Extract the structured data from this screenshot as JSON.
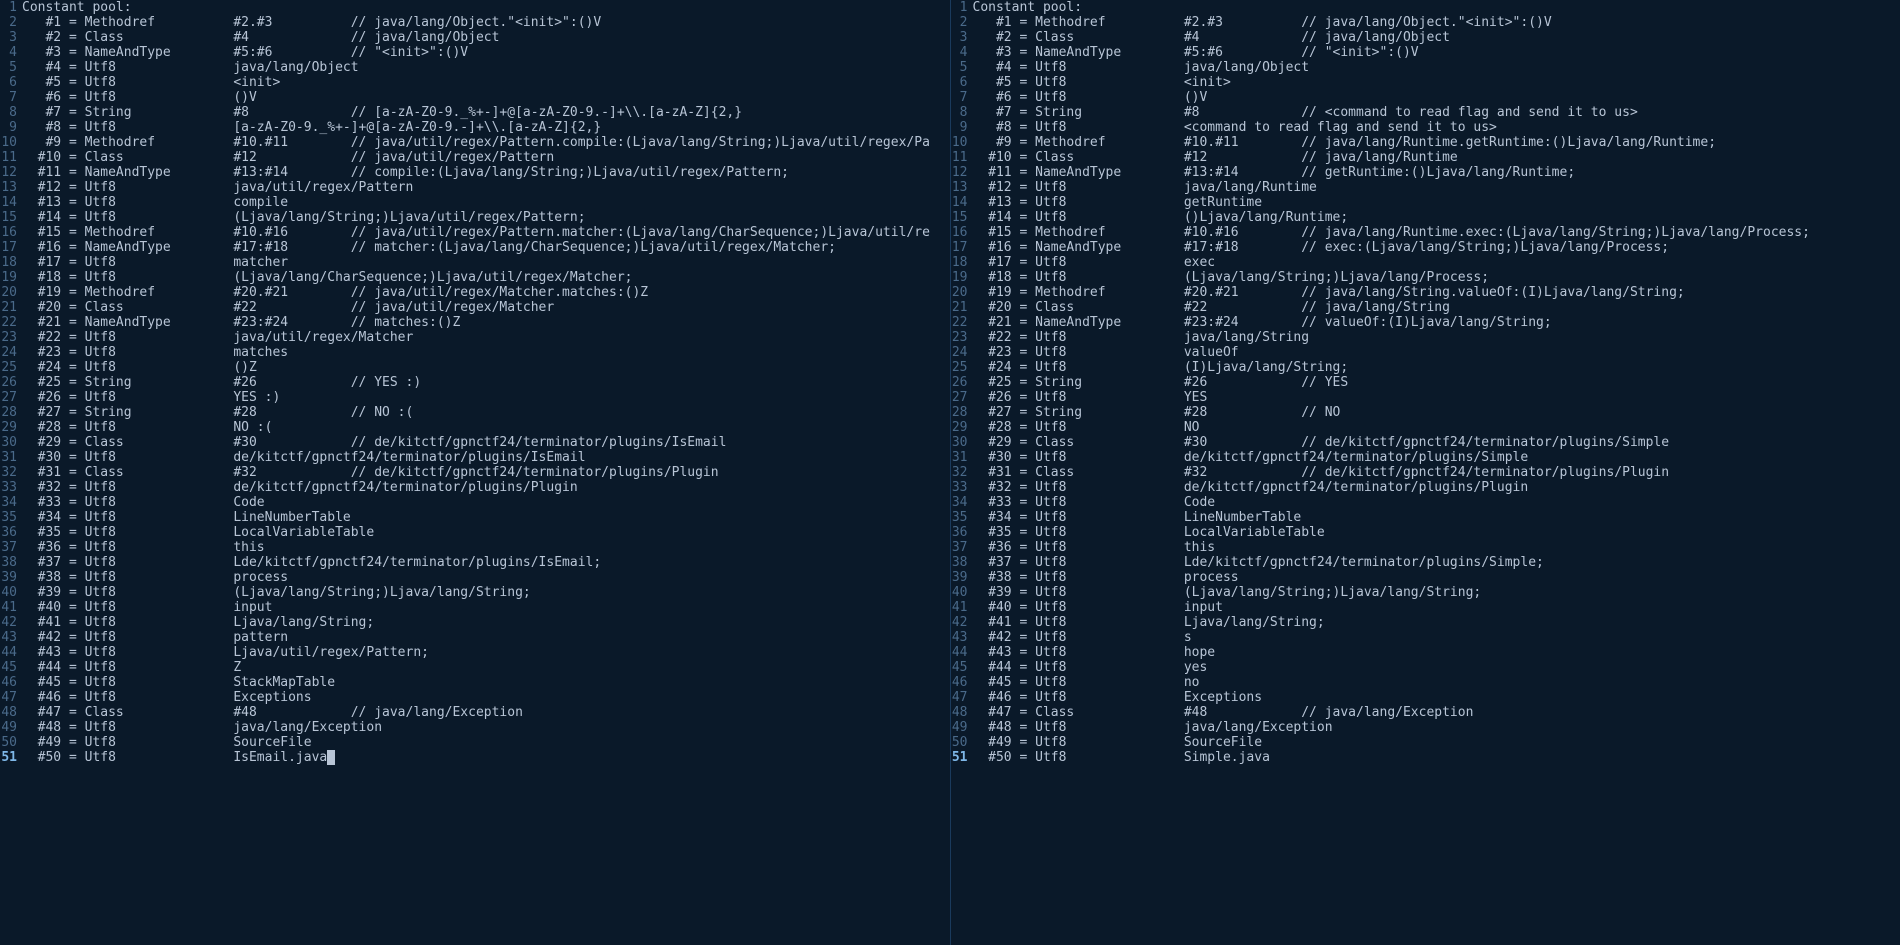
{
  "panes": [
    {
      "current_line": 51,
      "lines": [
        "Constant pool:",
        "   #1 = Methodref          #2.#3          // java/lang/Object.\"<init>\":()V",
        "   #2 = Class              #4             // java/lang/Object",
        "   #3 = NameAndType        #5:#6          // \"<init>\":()V",
        "   #4 = Utf8               java/lang/Object",
        "   #5 = Utf8               <init>",
        "   #6 = Utf8               ()V",
        "   #7 = String             #8             // [a-zA-Z0-9._%+-]+@[a-zA-Z0-9.-]+\\\\.[a-zA-Z]{2,}",
        "   #8 = Utf8               [a-zA-Z0-9._%+-]+@[a-zA-Z0-9.-]+\\\\.[a-zA-Z]{2,}",
        "   #9 = Methodref          #10.#11        // java/util/regex/Pattern.compile:(Ljava/lang/String;)Ljava/util/regex/Pa",
        "  #10 = Class              #12            // java/util/regex/Pattern",
        "  #11 = NameAndType        #13:#14        // compile:(Ljava/lang/String;)Ljava/util/regex/Pattern;",
        "  #12 = Utf8               java/util/regex/Pattern",
        "  #13 = Utf8               compile",
        "  #14 = Utf8               (Ljava/lang/String;)Ljava/util/regex/Pattern;",
        "  #15 = Methodref          #10.#16        // java/util/regex/Pattern.matcher:(Ljava/lang/CharSequence;)Ljava/util/re",
        "  #16 = NameAndType        #17:#18        // matcher:(Ljava/lang/CharSequence;)Ljava/util/regex/Matcher;",
        "  #17 = Utf8               matcher",
        "  #18 = Utf8               (Ljava/lang/CharSequence;)Ljava/util/regex/Matcher;",
        "  #19 = Methodref          #20.#21        // java/util/regex/Matcher.matches:()Z",
        "  #20 = Class              #22            // java/util/regex/Matcher",
        "  #21 = NameAndType        #23:#24        // matches:()Z",
        "  #22 = Utf8               java/util/regex/Matcher",
        "  #23 = Utf8               matches",
        "  #24 = Utf8               ()Z",
        "  #25 = String             #26            // YES :)",
        "  #26 = Utf8               YES :)",
        "  #27 = String             #28            // NO :(",
        "  #28 = Utf8               NO :(",
        "  #29 = Class              #30            // de/kitctf/gpnctf24/terminator/plugins/IsEmail",
        "  #30 = Utf8               de/kitctf/gpnctf24/terminator/plugins/IsEmail",
        "  #31 = Class              #32            // de/kitctf/gpnctf24/terminator/plugins/Plugin",
        "  #32 = Utf8               de/kitctf/gpnctf24/terminator/plugins/Plugin",
        "  #33 = Utf8               Code",
        "  #34 = Utf8               LineNumberTable",
        "  #35 = Utf8               LocalVariableTable",
        "  #36 = Utf8               this",
        "  #37 = Utf8               Lde/kitctf/gpnctf24/terminator/plugins/IsEmail;",
        "  #38 = Utf8               process",
        "  #39 = Utf8               (Ljava/lang/String;)Ljava/lang/String;",
        "  #40 = Utf8               input",
        "  #41 = Utf8               Ljava/lang/String;",
        "  #42 = Utf8               pattern",
        "  #43 = Utf8               Ljava/util/regex/Pattern;",
        "  #44 = Utf8               Z",
        "  #45 = Utf8               StackMapTable",
        "  #46 = Utf8               Exceptions",
        "  #47 = Class              #48            // java/lang/Exception",
        "  #48 = Utf8               java/lang/Exception",
        "  #49 = Utf8               SourceFile",
        "  #50 = Utf8               IsEmail.java"
      ]
    },
    {
      "current_line": 51,
      "lines": [
        "Constant pool:",
        "   #1 = Methodref          #2.#3          // java/lang/Object.\"<init>\":()V",
        "   #2 = Class              #4             // java/lang/Object",
        "   #3 = NameAndType        #5:#6          // \"<init>\":()V",
        "   #4 = Utf8               java/lang/Object",
        "   #5 = Utf8               <init>",
        "   #6 = Utf8               ()V",
        "   #7 = String             #8             // <command to read flag and send it to us>",
        "   #8 = Utf8               <command to read flag and send it to us>",
        "   #9 = Methodref          #10.#11        // java/lang/Runtime.getRuntime:()Ljava/lang/Runtime;",
        "  #10 = Class              #12            // java/lang/Runtime",
        "  #11 = NameAndType        #13:#14        // getRuntime:()Ljava/lang/Runtime;",
        "  #12 = Utf8               java/lang/Runtime",
        "  #13 = Utf8               getRuntime",
        "  #14 = Utf8               ()Ljava/lang/Runtime;",
        "  #15 = Methodref          #10.#16        // java/lang/Runtime.exec:(Ljava/lang/String;)Ljava/lang/Process;",
        "  #16 = NameAndType        #17:#18        // exec:(Ljava/lang/String;)Ljava/lang/Process;",
        "  #17 = Utf8               exec",
        "  #18 = Utf8               (Ljava/lang/String;)Ljava/lang/Process;",
        "  #19 = Methodref          #20.#21        // java/lang/String.valueOf:(I)Ljava/lang/String;",
        "  #20 = Class              #22            // java/lang/String",
        "  #21 = NameAndType        #23:#24        // valueOf:(I)Ljava/lang/String;",
        "  #22 = Utf8               java/lang/String",
        "  #23 = Utf8               valueOf",
        "  #24 = Utf8               (I)Ljava/lang/String;",
        "  #25 = String             #26            // YES",
        "  #26 = Utf8               YES",
        "  #27 = String             #28            // NO",
        "  #28 = Utf8               NO",
        "  #29 = Class              #30            // de/kitctf/gpnctf24/terminator/plugins/Simple",
        "  #30 = Utf8               de/kitctf/gpnctf24/terminator/plugins/Simple",
        "  #31 = Class              #32            // de/kitctf/gpnctf24/terminator/plugins/Plugin",
        "  #32 = Utf8               de/kitctf/gpnctf24/terminator/plugins/Plugin",
        "  #33 = Utf8               Code",
        "  #34 = Utf8               LineNumberTable",
        "  #35 = Utf8               LocalVariableTable",
        "  #36 = Utf8               this",
        "  #37 = Utf8               Lde/kitctf/gpnctf24/terminator/plugins/Simple;",
        "  #38 = Utf8               process",
        "  #39 = Utf8               (Ljava/lang/String;)Ljava/lang/String;",
        "  #40 = Utf8               input",
        "  #41 = Utf8               Ljava/lang/String;",
        "  #42 = Utf8               s",
        "  #43 = Utf8               hope",
        "  #44 = Utf8               yes",
        "  #45 = Utf8               no",
        "  #46 = Utf8               Exceptions",
        "  #47 = Class              #48            // java/lang/Exception",
        "  #48 = Utf8               java/lang/Exception",
        "  #49 = Utf8               SourceFile",
        "  #50 = Utf8               Simple.java"
      ]
    }
  ]
}
